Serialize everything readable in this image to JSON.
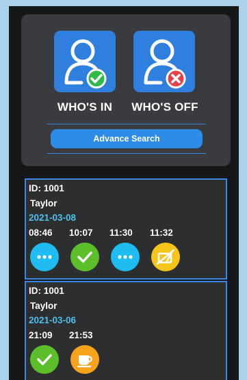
{
  "header": {
    "whos_in_label": "WHO'S IN",
    "whos_off_label": "WHO'S OFF",
    "advance_search_label": "Advance Search"
  },
  "colors": {
    "tile_blue": "#2f80de",
    "dots_cyan": "#1ebcf0",
    "check_green": "#5cbf2a",
    "note_yellow": "#f5c518",
    "coffee_orange": "#f7a21b",
    "date_cyan": "#4fc0ec"
  },
  "records": [
    {
      "id": "ID: 1001",
      "name": "Taylor",
      "date": "2021-03-08",
      "entries": [
        {
          "time": "08:46",
          "icon": "more-dots-icon"
        },
        {
          "time": "10:07",
          "icon": "check-icon"
        },
        {
          "time": "11:30",
          "icon": "more-dots-icon"
        },
        {
          "time": "11:32",
          "icon": "no-sign-icon"
        }
      ]
    },
    {
      "id": "ID: 1001",
      "name": "Taylor",
      "date": "2021-03-06",
      "entries": [
        {
          "time": "21:09",
          "icon": "check-icon"
        },
        {
          "time": "21:53",
          "icon": "coffee-cup-icon"
        }
      ]
    }
  ]
}
